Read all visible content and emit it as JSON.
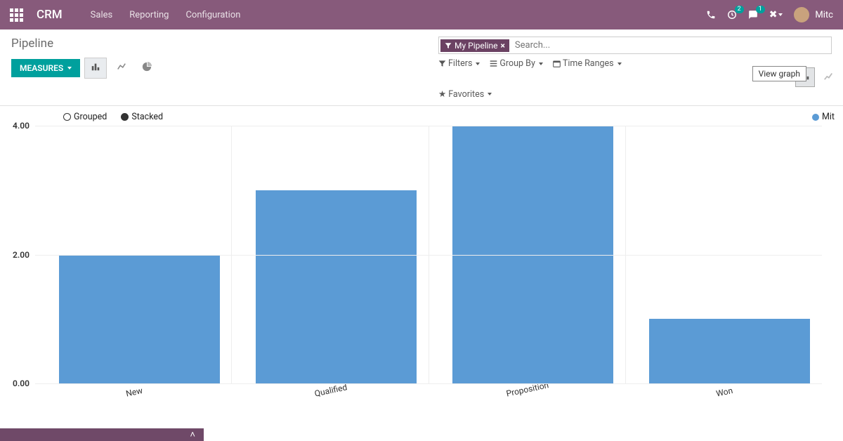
{
  "topnav": {
    "brand": "CRM",
    "links": [
      "Sales",
      "Reporting",
      "Configuration"
    ],
    "activity_badge": "2",
    "messages_badge": "1",
    "user_name": "Mitc"
  },
  "cp": {
    "breadcrumb": "Pipeline",
    "measures_label": "MEASURES",
    "active_filter": "My Pipeline",
    "search_placeholder": "Search...",
    "filters_label": "Filters",
    "groupby_label": "Group By",
    "timeranges_label": "Time Ranges",
    "favorites_label": "Favorites",
    "tooltip": "View graph"
  },
  "legend": {
    "grouped": "Grouped",
    "stacked": "Stacked",
    "series": "Mit"
  },
  "chart_data": {
    "type": "bar",
    "categories": [
      "New",
      "Qualified",
      "Proposition",
      "Won"
    ],
    "values": [
      2,
      3,
      4,
      1
    ],
    "title": "",
    "xlabel": "",
    "ylabel": "",
    "ylim": [
      0,
      4
    ],
    "yticks": [
      0.0,
      2.0,
      4.0
    ],
    "mode": "Stacked",
    "series_name": "Mit",
    "color": "#5B9BD5"
  }
}
